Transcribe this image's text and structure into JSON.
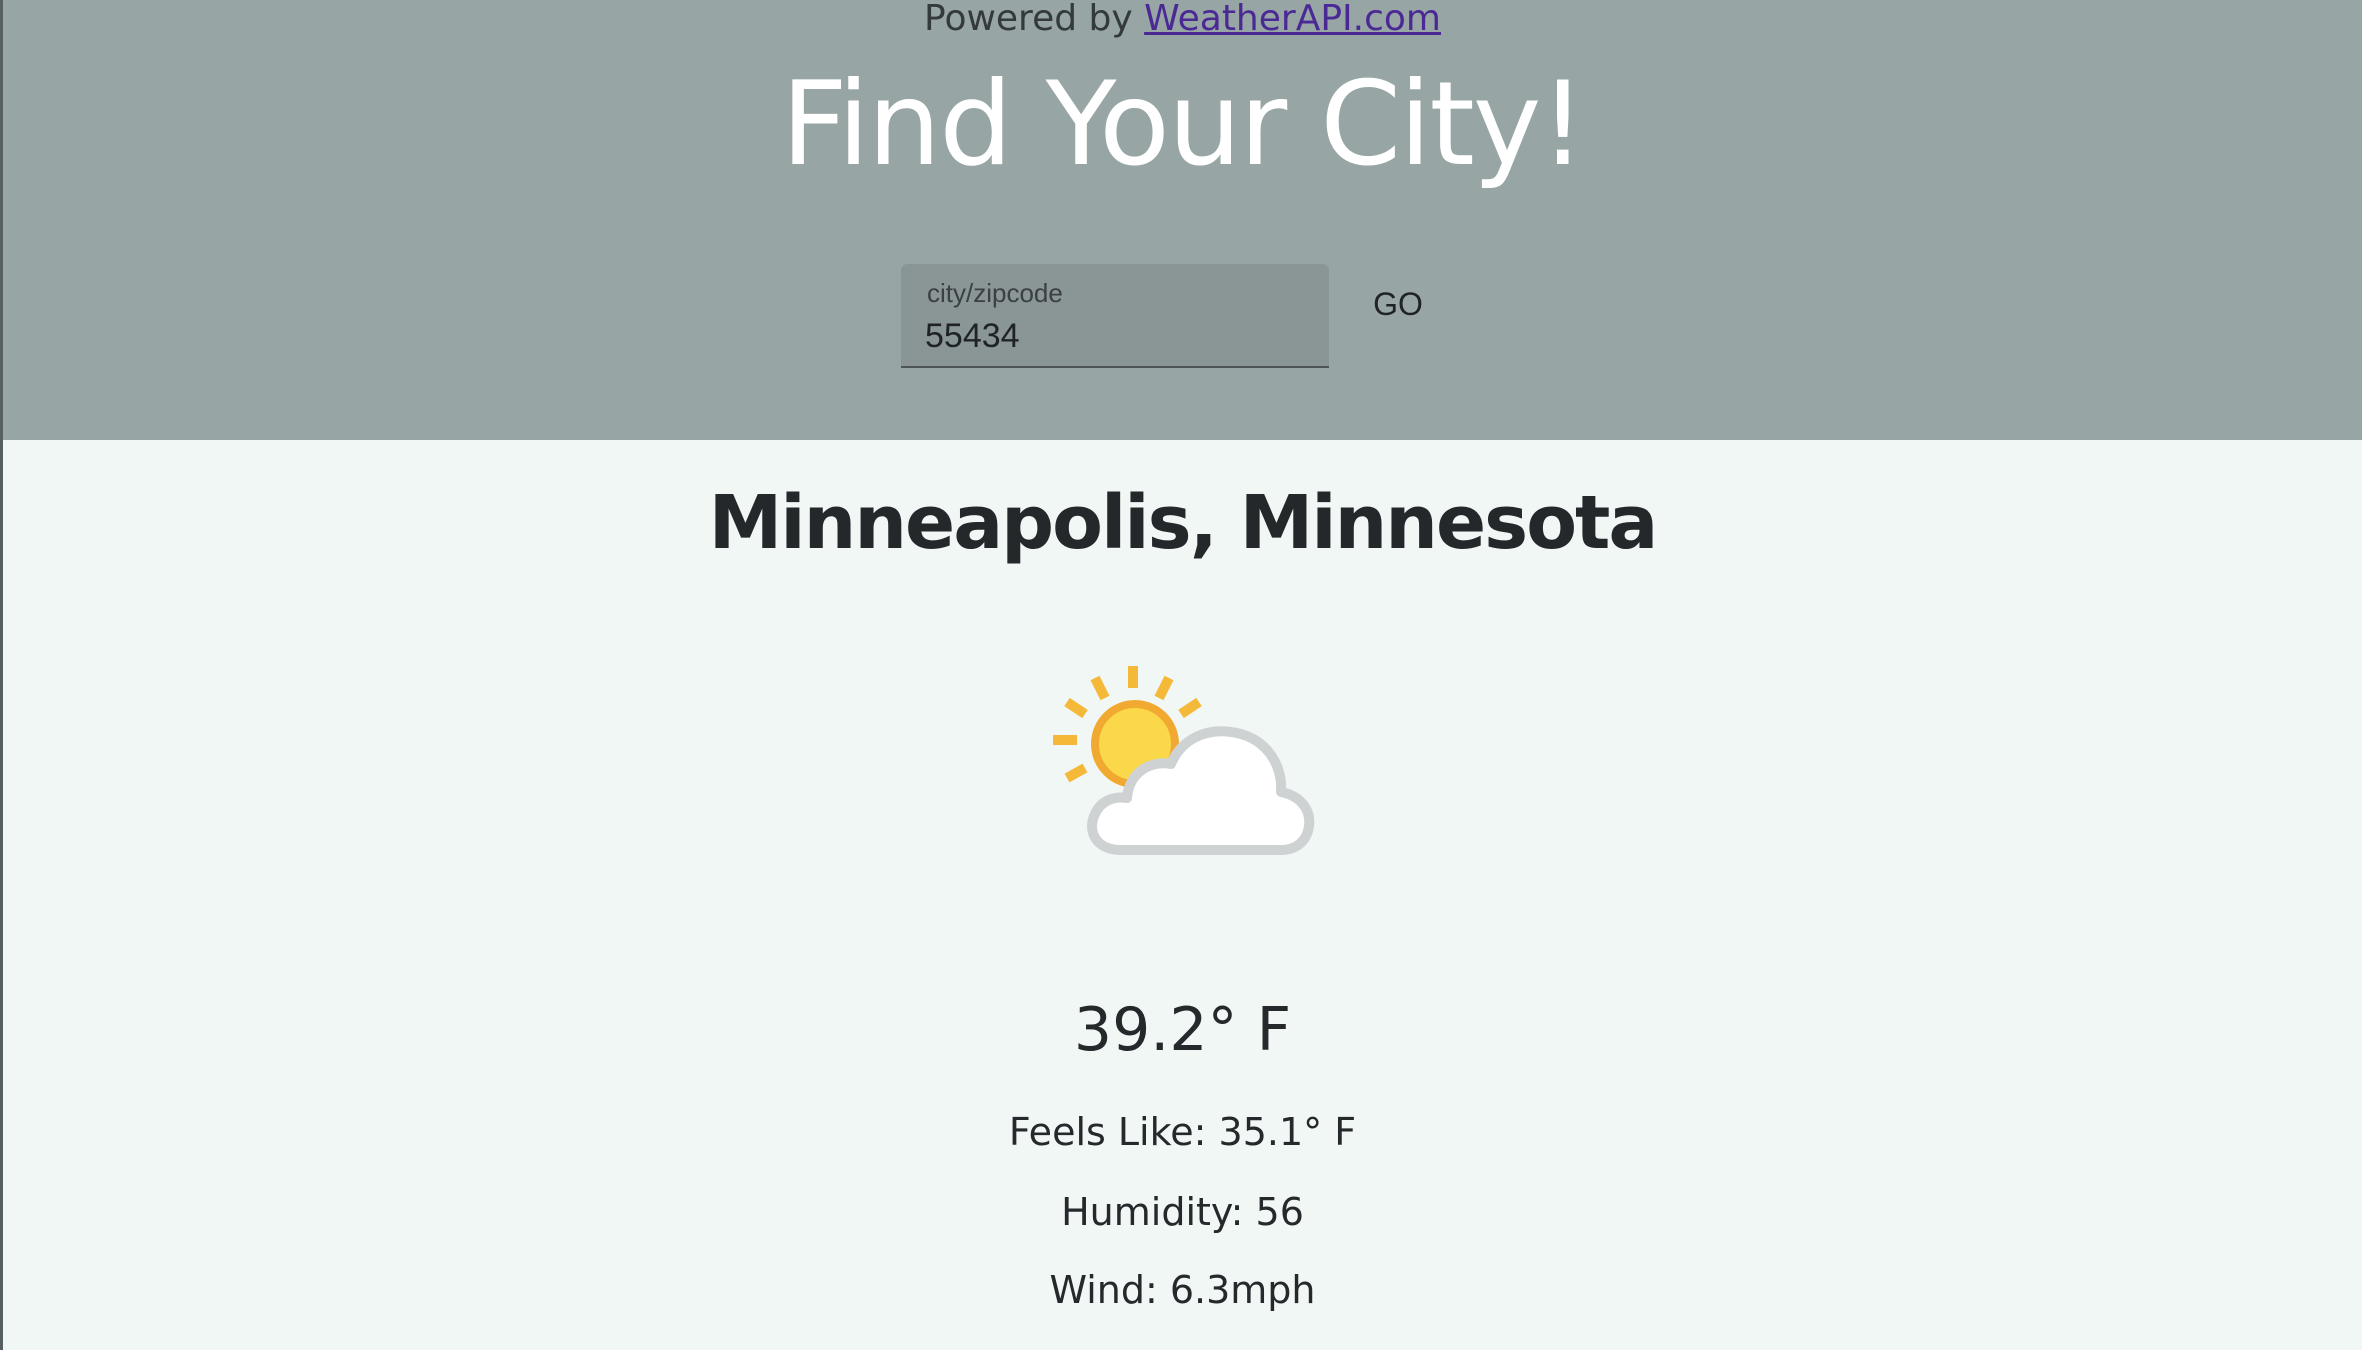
{
  "header": {
    "powered_prefix": "Powered by ",
    "powered_link": "WeatherAPI.com",
    "title": "Find Your City!"
  },
  "search": {
    "label": "city/zipcode",
    "value": "55434",
    "button_label": "GO"
  },
  "weather": {
    "city": "Minneapolis, Minnesota",
    "condition_icon": "partly-cloudy-icon",
    "temperature": "39.2° F",
    "feels_like": "Feels Like: 35.1° F",
    "humidity": "Humidity: 56",
    "wind": "Wind: 6.3mph"
  },
  "colors": {
    "header_bg": "#97a5a5",
    "page_bg": "#f1f7f5",
    "link": "#4b2995",
    "sun": "#f5b93a",
    "cloud": "#d3d5d5"
  }
}
